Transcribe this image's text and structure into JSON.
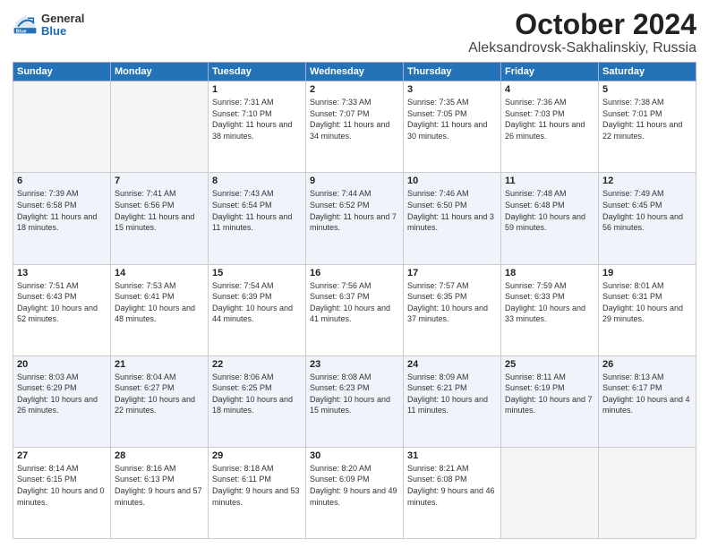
{
  "logo": {
    "general": "General",
    "blue": "Blue"
  },
  "header": {
    "month": "October 2024",
    "location": "Aleksandrovsk-Sakhalinskiy, Russia"
  },
  "weekdays": [
    "Sunday",
    "Monday",
    "Tuesday",
    "Wednesday",
    "Thursday",
    "Friday",
    "Saturday"
  ],
  "weeks": [
    [
      {
        "day": "",
        "sunrise": "",
        "sunset": "",
        "daylight": ""
      },
      {
        "day": "",
        "sunrise": "",
        "sunset": "",
        "daylight": ""
      },
      {
        "day": "1",
        "sunrise": "Sunrise: 7:31 AM",
        "sunset": "Sunset: 7:10 PM",
        "daylight": "Daylight: 11 hours and 38 minutes."
      },
      {
        "day": "2",
        "sunrise": "Sunrise: 7:33 AM",
        "sunset": "Sunset: 7:07 PM",
        "daylight": "Daylight: 11 hours and 34 minutes."
      },
      {
        "day": "3",
        "sunrise": "Sunrise: 7:35 AM",
        "sunset": "Sunset: 7:05 PM",
        "daylight": "Daylight: 11 hours and 30 minutes."
      },
      {
        "day": "4",
        "sunrise": "Sunrise: 7:36 AM",
        "sunset": "Sunset: 7:03 PM",
        "daylight": "Daylight: 11 hours and 26 minutes."
      },
      {
        "day": "5",
        "sunrise": "Sunrise: 7:38 AM",
        "sunset": "Sunset: 7:01 PM",
        "daylight": "Daylight: 11 hours and 22 minutes."
      }
    ],
    [
      {
        "day": "6",
        "sunrise": "Sunrise: 7:39 AM",
        "sunset": "Sunset: 6:58 PM",
        "daylight": "Daylight: 11 hours and 18 minutes."
      },
      {
        "day": "7",
        "sunrise": "Sunrise: 7:41 AM",
        "sunset": "Sunset: 6:56 PM",
        "daylight": "Daylight: 11 hours and 15 minutes."
      },
      {
        "day": "8",
        "sunrise": "Sunrise: 7:43 AM",
        "sunset": "Sunset: 6:54 PM",
        "daylight": "Daylight: 11 hours and 11 minutes."
      },
      {
        "day": "9",
        "sunrise": "Sunrise: 7:44 AM",
        "sunset": "Sunset: 6:52 PM",
        "daylight": "Daylight: 11 hours and 7 minutes."
      },
      {
        "day": "10",
        "sunrise": "Sunrise: 7:46 AM",
        "sunset": "Sunset: 6:50 PM",
        "daylight": "Daylight: 11 hours and 3 minutes."
      },
      {
        "day": "11",
        "sunrise": "Sunrise: 7:48 AM",
        "sunset": "Sunset: 6:48 PM",
        "daylight": "Daylight: 10 hours and 59 minutes."
      },
      {
        "day": "12",
        "sunrise": "Sunrise: 7:49 AM",
        "sunset": "Sunset: 6:45 PM",
        "daylight": "Daylight: 10 hours and 56 minutes."
      }
    ],
    [
      {
        "day": "13",
        "sunrise": "Sunrise: 7:51 AM",
        "sunset": "Sunset: 6:43 PM",
        "daylight": "Daylight: 10 hours and 52 minutes."
      },
      {
        "day": "14",
        "sunrise": "Sunrise: 7:53 AM",
        "sunset": "Sunset: 6:41 PM",
        "daylight": "Daylight: 10 hours and 48 minutes."
      },
      {
        "day": "15",
        "sunrise": "Sunrise: 7:54 AM",
        "sunset": "Sunset: 6:39 PM",
        "daylight": "Daylight: 10 hours and 44 minutes."
      },
      {
        "day": "16",
        "sunrise": "Sunrise: 7:56 AM",
        "sunset": "Sunset: 6:37 PM",
        "daylight": "Daylight: 10 hours and 41 minutes."
      },
      {
        "day": "17",
        "sunrise": "Sunrise: 7:57 AM",
        "sunset": "Sunset: 6:35 PM",
        "daylight": "Daylight: 10 hours and 37 minutes."
      },
      {
        "day": "18",
        "sunrise": "Sunrise: 7:59 AM",
        "sunset": "Sunset: 6:33 PM",
        "daylight": "Daylight: 10 hours and 33 minutes."
      },
      {
        "day": "19",
        "sunrise": "Sunrise: 8:01 AM",
        "sunset": "Sunset: 6:31 PM",
        "daylight": "Daylight: 10 hours and 29 minutes."
      }
    ],
    [
      {
        "day": "20",
        "sunrise": "Sunrise: 8:03 AM",
        "sunset": "Sunset: 6:29 PM",
        "daylight": "Daylight: 10 hours and 26 minutes."
      },
      {
        "day": "21",
        "sunrise": "Sunrise: 8:04 AM",
        "sunset": "Sunset: 6:27 PM",
        "daylight": "Daylight: 10 hours and 22 minutes."
      },
      {
        "day": "22",
        "sunrise": "Sunrise: 8:06 AM",
        "sunset": "Sunset: 6:25 PM",
        "daylight": "Daylight: 10 hours and 18 minutes."
      },
      {
        "day": "23",
        "sunrise": "Sunrise: 8:08 AM",
        "sunset": "Sunset: 6:23 PM",
        "daylight": "Daylight: 10 hours and 15 minutes."
      },
      {
        "day": "24",
        "sunrise": "Sunrise: 8:09 AM",
        "sunset": "Sunset: 6:21 PM",
        "daylight": "Daylight: 10 hours and 11 minutes."
      },
      {
        "day": "25",
        "sunrise": "Sunrise: 8:11 AM",
        "sunset": "Sunset: 6:19 PM",
        "daylight": "Daylight: 10 hours and 7 minutes."
      },
      {
        "day": "26",
        "sunrise": "Sunrise: 8:13 AM",
        "sunset": "Sunset: 6:17 PM",
        "daylight": "Daylight: 10 hours and 4 minutes."
      }
    ],
    [
      {
        "day": "27",
        "sunrise": "Sunrise: 8:14 AM",
        "sunset": "Sunset: 6:15 PM",
        "daylight": "Daylight: 10 hours and 0 minutes."
      },
      {
        "day": "28",
        "sunrise": "Sunrise: 8:16 AM",
        "sunset": "Sunset: 6:13 PM",
        "daylight": "Daylight: 9 hours and 57 minutes."
      },
      {
        "day": "29",
        "sunrise": "Sunrise: 8:18 AM",
        "sunset": "Sunset: 6:11 PM",
        "daylight": "Daylight: 9 hours and 53 minutes."
      },
      {
        "day": "30",
        "sunrise": "Sunrise: 8:20 AM",
        "sunset": "Sunset: 6:09 PM",
        "daylight": "Daylight: 9 hours and 49 minutes."
      },
      {
        "day": "31",
        "sunrise": "Sunrise: 8:21 AM",
        "sunset": "Sunset: 6:08 PM",
        "daylight": "Daylight: 9 hours and 46 minutes."
      },
      {
        "day": "",
        "sunrise": "",
        "sunset": "",
        "daylight": ""
      },
      {
        "day": "",
        "sunrise": "",
        "sunset": "",
        "daylight": ""
      }
    ]
  ]
}
